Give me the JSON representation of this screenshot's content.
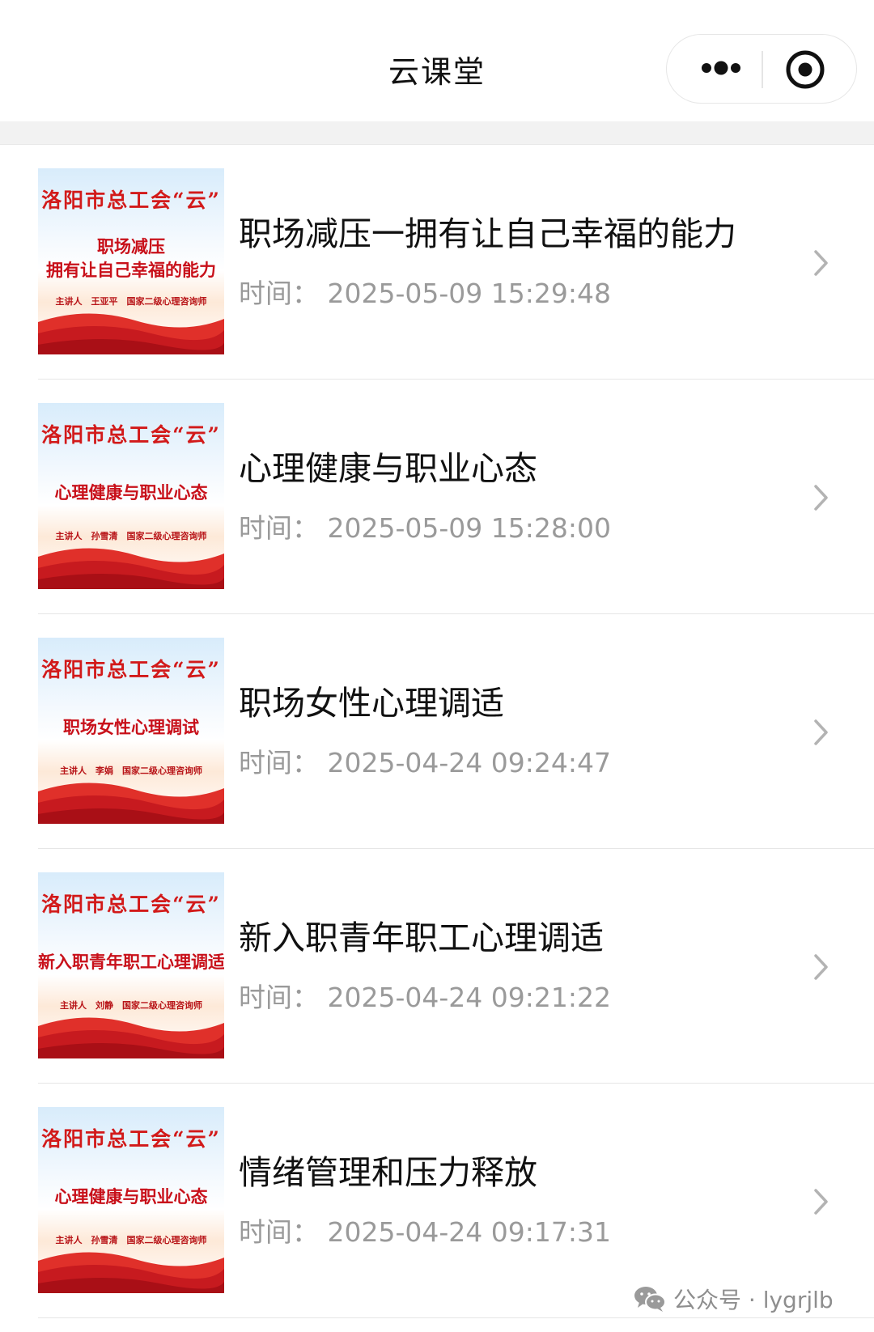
{
  "nav": {
    "title": "云课堂",
    "more_icon": "more-dots-icon",
    "close_icon": "target-close-icon"
  },
  "courses": [
    {
      "title": "职场减压一拥有让自己幸福的能力",
      "time": "时间：  2025-05-09 15:29:48",
      "thumb": {
        "org": "洛阳市总工会“云”",
        "sub": [
          "职场减压",
          "拥有让自己幸福的能力"
        ],
        "speaker": "主讲人　王亚平　国家二级心理咨询师"
      }
    },
    {
      "title": "心理健康与职业心态",
      "time": "时间：  2025-05-09 15:28:00",
      "thumb": {
        "org": "洛阳市总工会“云”",
        "sub": [
          "心理健康与职业心态"
        ],
        "speaker": "主讲人　孙雪清　国家二级心理咨询师"
      }
    },
    {
      "title": "职场女性心理调适",
      "time": "时间：  2025-04-24 09:24:47",
      "thumb": {
        "org": "洛阳市总工会“云”",
        "sub": [
          "职场女性心理调试"
        ],
        "speaker": "主讲人　李娟　国家二级心理咨询师"
      }
    },
    {
      "title": "新入职青年职工心理调适",
      "time": "时间：  2025-04-24 09:21:22",
      "thumb": {
        "org": "洛阳市总工会“云”",
        "sub": [
          "新入职青年职工心理调适"
        ],
        "speaker": "主讲人　刘静　国家二级心理咨询师"
      }
    },
    {
      "title": "情绪管理和压力释放",
      "time": "时间：  2025-04-24 09:17:31",
      "thumb": {
        "org": "洛阳市总工会“云”",
        "sub": [
          "心理健康与职业心态"
        ],
        "speaker": "主讲人　孙雪清　国家二级心理咨询师"
      }
    }
  ],
  "watermark": {
    "text": "公众号 · lygrjlb",
    "icon": "wechat-icon"
  },
  "colors": {
    "title": "#111111",
    "time": "#9a9a9a",
    "thumb_red": "#d21a1a",
    "divider": "#e6e6e6"
  }
}
